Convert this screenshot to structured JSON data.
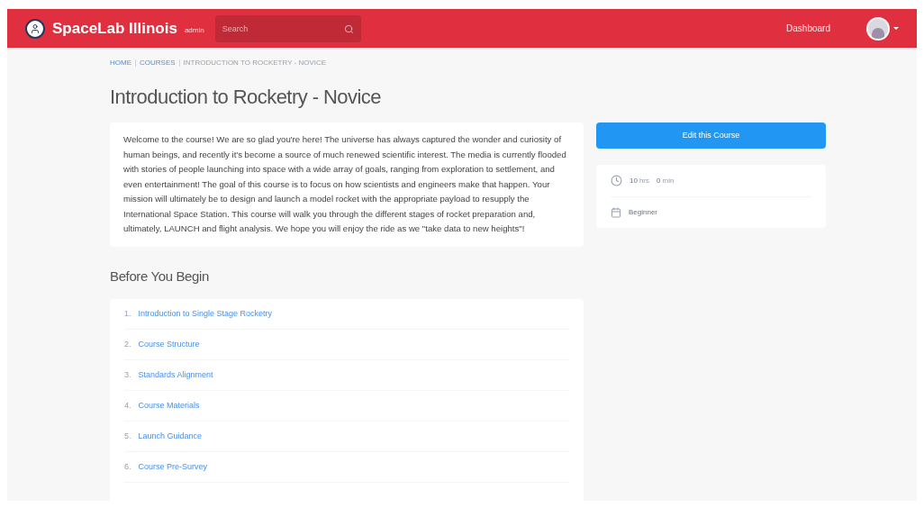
{
  "header": {
    "brand": "SpaceLab Illinois",
    "brand_tag": "admin",
    "search": {
      "placeholder": "Search"
    },
    "nav": [
      {
        "label": "Dashboard"
      }
    ]
  },
  "breadcrumb": [
    {
      "label": "HOME",
      "kind": "link"
    },
    {
      "label": "COURSES",
      "kind": "link"
    },
    {
      "label": "INTRODUCTION TO ROCKETRY - NOVICE",
      "kind": "current"
    }
  ],
  "title": "Introduction to Rocketry - Novice",
  "description": "Welcome to the course! We are so glad you're here! The universe has always captured the wonder and curiosity of human beings, and recently it's become a source of much renewed scientific interest. The media is currently flooded with stories of people launching into space with a wide array of goals, ranging from exploration to settlement, and even entertainment! The goal of this course is to focus on how scientists and engineers make that happen. Your mission will ultimately be to design and launch a model rocket with the appropriate payload to resupply the International Space Station. This course will walk you through the different stages of rocket preparation and, ultimately, LAUNCH and flight analysis. We hope you will enjoy the ride as we \"take data to new heights\"!",
  "edit_button": "Edit this Course",
  "info": {
    "duration": [
      {
        "value": "10",
        "unit": "hrs"
      },
      {
        "value": "0",
        "unit": "min"
      }
    ],
    "level": "Beginner"
  },
  "section": {
    "title": "Before You Begin",
    "items": [
      {
        "number": "1.",
        "label": "Introduction to Single Stage Rocketry"
      },
      {
        "number": "2.",
        "label": "Course Structure"
      },
      {
        "number": "3.",
        "label": "Standards Alignment"
      },
      {
        "number": "4.",
        "label": "Course Materials"
      },
      {
        "number": "5.",
        "label": "Launch Guidance"
      },
      {
        "number": "6.",
        "label": "Course Pre-Survey"
      }
    ]
  }
}
